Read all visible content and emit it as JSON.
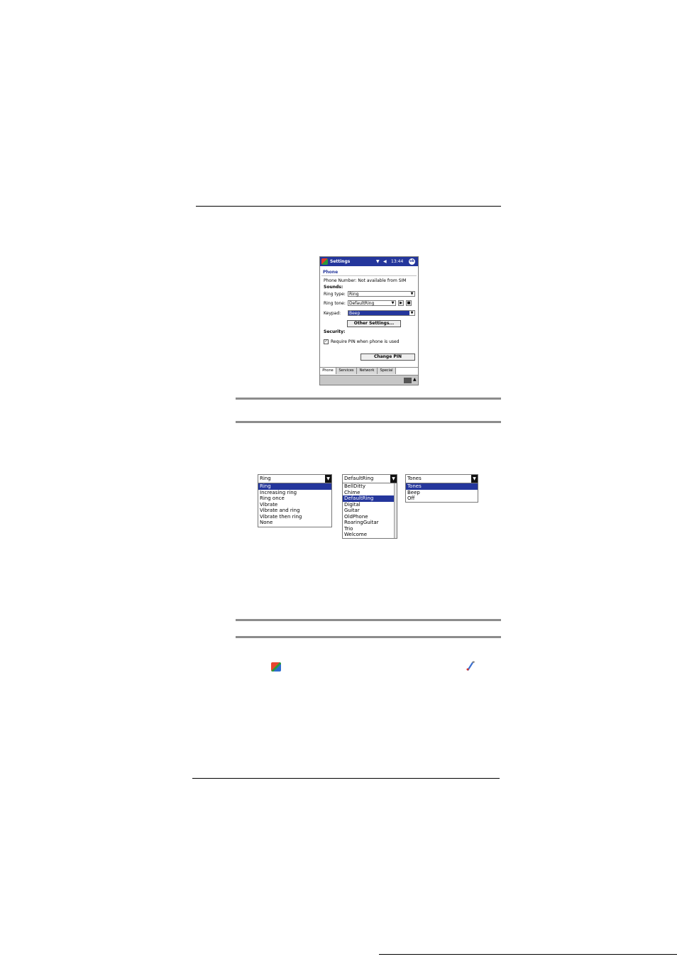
{
  "pda": {
    "title": "Settings",
    "time": "13:44",
    "ok_label": "ok",
    "heading": "Phone",
    "phone_number_line": "Phone Number: Not available from SIM",
    "sounds_label": "Sounds:",
    "ring_type_label": "Ring type:",
    "ring_type_value": "Ring",
    "ring_tone_label": "Ring tone:",
    "ring_tone_value": "DefaultRing",
    "keypad_label": "Keypad:",
    "keypad_value": "Beep",
    "other_settings_button": "Other Settings...",
    "security_label": "Security:",
    "require_pin_label": "Require PIN when phone is used",
    "require_pin_checked": true,
    "change_pin_button": "Change PIN",
    "tabs": [
      "Phone",
      "Services",
      "Network",
      "Special"
    ],
    "active_tab": "Phone"
  },
  "ring_type_list": {
    "selected": "Ring",
    "items": [
      "Ring",
      "Increasing ring",
      "Ring once",
      "Vibrate",
      "Vibrate and ring",
      "Vibrate then ring",
      "None"
    ],
    "highlighted": "Ring"
  },
  "ring_tone_list": {
    "selected": "DefaultRing",
    "items": [
      "BellDitty",
      "Chime",
      "DefaultRing",
      "Digital",
      "Guitar",
      "OldPhone",
      "RoaringGuitar",
      "Trio",
      "Welcome"
    ],
    "highlighted": "DefaultRing"
  },
  "keypad_list": {
    "selected": "Tones",
    "items": [
      "Tones",
      "Beep",
      "Off"
    ],
    "highlighted": "Tones"
  },
  "icons": {
    "start": "windows-start-icon",
    "phone": "phone-settings-icon"
  }
}
